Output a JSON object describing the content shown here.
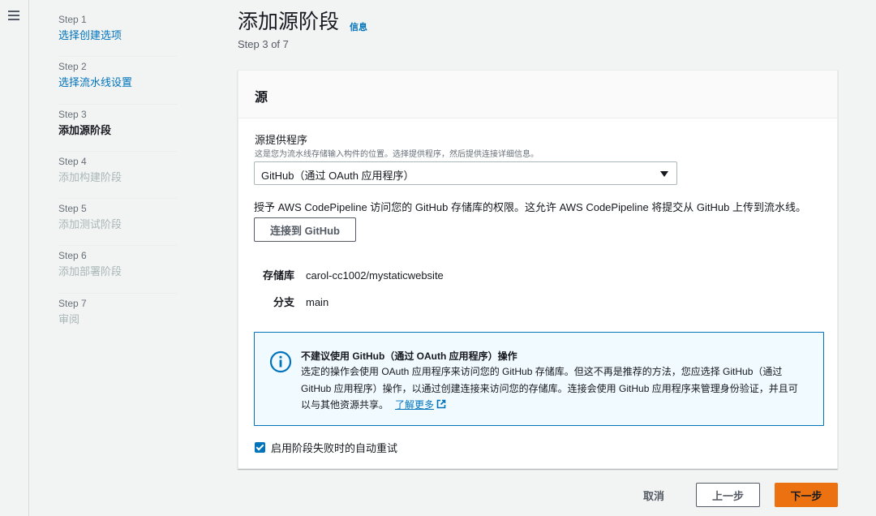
{
  "steps": [
    {
      "num": "Step 1",
      "label": "选择创建选项",
      "state": "link"
    },
    {
      "num": "Step 2",
      "label": "选择流水线设置",
      "state": "link"
    },
    {
      "num": "Step 3",
      "label": "添加源阶段",
      "state": "current"
    },
    {
      "num": "Step 4",
      "label": "添加构建阶段",
      "state": "disabled"
    },
    {
      "num": "Step 5",
      "label": "添加测试阶段",
      "state": "disabled"
    },
    {
      "num": "Step 6",
      "label": "添加部署阶段",
      "state": "disabled"
    },
    {
      "num": "Step 7",
      "label": "审阅",
      "state": "disabled"
    }
  ],
  "header": {
    "title": "添加源阶段",
    "info": "信息",
    "step_counter": "Step 3 of 7"
  },
  "panel": {
    "title": "源",
    "provider_label": "源提供程序",
    "provider_desc": "这是您为流水线存储输入构件的位置。选择提供程序，然后提供连接详细信息。",
    "provider_value": "GitHub（通过 OAuth 应用程序）",
    "grant_text": "授予 AWS CodePipeline 访问您的 GitHub 存储库的权限。这允许 AWS CodePipeline 将提交从 GitHub 上传到流水线。",
    "connect_button": "连接到 GitHub",
    "repo_key": "存储库",
    "repo_value": "carol-cc1002/mystaticwebsite",
    "branch_key": "分支",
    "branch_value": "main",
    "alert": {
      "title": "不建议使用 GitHub（通过 OAuth 应用程序）操作",
      "body": "选定的操作会使用 OAuth 应用程序来访问您的 GitHub 存储库。但这不再是推荐的方法，您应选择 GitHub（通过 GitHub 应用程序）操作，以通过创建连接来访问您的存储库。连接会使用 GitHub 应用程序来管理身份验证，并且可以与其他资源共享。",
      "learn_more": "了解更多"
    },
    "retry_label": "启用阶段失败时的自动重试",
    "retry_checked": true
  },
  "footer": {
    "cancel": "取消",
    "previous": "上一步",
    "next": "下一步"
  },
  "colors": {
    "link": "#0073bb",
    "primary": "#ec7211",
    "info_border": "#0073bb"
  }
}
